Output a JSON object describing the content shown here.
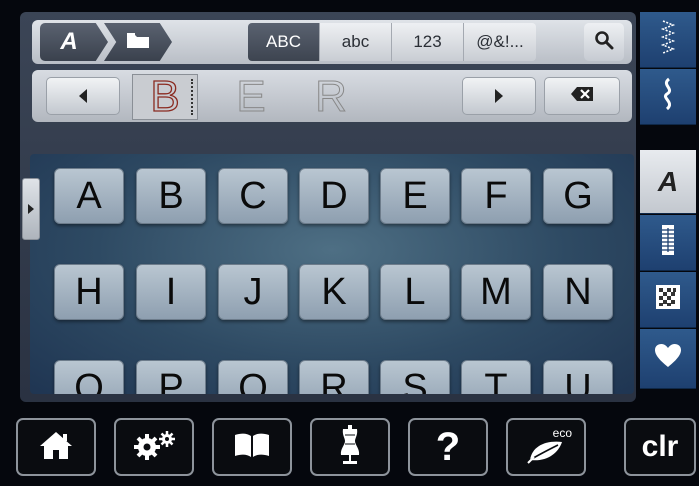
{
  "mode_bar": {
    "breadcrumb": [
      {
        "icon": "alphabet-a-icon",
        "label": "A"
      },
      {
        "icon": "folder-icon"
      }
    ],
    "charset_tabs": [
      {
        "label": "ABC",
        "active": true
      },
      {
        "label": "abc",
        "active": false
      },
      {
        "label": "123",
        "active": false
      },
      {
        "label": "@&!...",
        "active": false
      }
    ],
    "search_icon": "magnifier-icon"
  },
  "preview": {
    "chars": [
      "B",
      "E",
      "R"
    ],
    "cursor_index": 0,
    "prev_icon": "triangle-left-icon",
    "next_icon": "triangle-right-icon",
    "backspace_icon": "backspace-icon"
  },
  "keyboard": {
    "rows": [
      [
        "A",
        "B",
        "C",
        "D",
        "E",
        "F",
        "G"
      ],
      [
        "H",
        "I",
        "J",
        "K",
        "L",
        "M",
        "N"
      ],
      [
        "O",
        "P",
        "Q",
        "R",
        "S",
        "T",
        "U"
      ]
    ]
  },
  "right_rail": [
    {
      "name": "practical-stitches",
      "icon": "zigzag-stitch-icon",
      "active": false
    },
    {
      "name": "decorative-stitches",
      "icon": "decorative-stitch-icon",
      "active": false
    },
    {
      "name": "alphabets",
      "icon": "alphabet-a-icon",
      "label": "A",
      "active": true
    },
    {
      "name": "buttonholes",
      "icon": "buttonhole-icon",
      "active": false
    },
    {
      "name": "quilt-stitches",
      "icon": "quilt-icon",
      "active": false
    },
    {
      "name": "personal-program",
      "icon": "heart-icon",
      "active": false
    }
  ],
  "bottom_bar": {
    "home_icon": "home-icon",
    "setup_icon": "gears-icon",
    "tutorial_icon": "book-icon",
    "creative_consultant_icon": "dress-form-icon",
    "help_label": "?",
    "eco_label": "eco",
    "eco_icon": "leaf-icon",
    "clr_label": "clr"
  },
  "colors": {
    "rail_blue": "#1e4070",
    "active_tab": "#3d4450",
    "key_face": "#a8b7c4",
    "stitch_red": "#8a2a20"
  }
}
